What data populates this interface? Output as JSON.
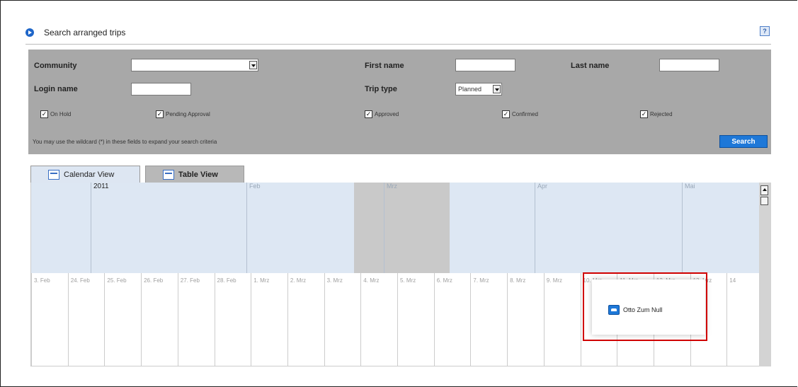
{
  "header": {
    "title": "Search arranged trips",
    "help_label": "?"
  },
  "form": {
    "community_label": "Community",
    "community_value": "",
    "first_name_label": "First name",
    "first_name_value": "",
    "last_name_label": "Last name",
    "last_name_value": "",
    "login_name_label": "Login name",
    "login_name_value": "",
    "trip_type_label": "Trip type",
    "trip_type_value": "Planned",
    "statuses": [
      {
        "label": "On Hold",
        "checked": true
      },
      {
        "label": "Pending Approval",
        "checked": true
      },
      {
        "label": "Approved",
        "checked": true
      },
      {
        "label": "Confirmed",
        "checked": true
      },
      {
        "label": "Rejected",
        "checked": true
      }
    ],
    "hint": "You may use the wildcard (*) in these fields to expand your search criteria",
    "search_label": "Search"
  },
  "tabs": [
    {
      "label": "Calendar View",
      "active": true
    },
    {
      "label": "Table View",
      "active": false
    }
  ],
  "calendar": {
    "year": "2011",
    "months": [
      "Feb",
      "Mrz",
      "Apr",
      "Mai"
    ],
    "days": [
      "3. Feb",
      "24. Feb",
      "25. Feb",
      "26. Feb",
      "27. Feb",
      "28. Feb",
      "1. Mrz",
      "2. Mrz",
      "3. Mrz",
      "4. Mrz",
      "5. Mrz",
      "6. Mrz",
      "7. Mrz",
      "8. Mrz",
      "9. Mrz",
      "10. Mrz",
      "11. Mrz",
      "12. Mrz",
      "13. Mrz",
      "14"
    ],
    "trip_label": "Otto Zum Null"
  },
  "colors": {
    "accent": "#1e78d8",
    "highlight": "#d00000",
    "panel": "#a8a8a8",
    "calendar_band": "#dde7f3"
  }
}
